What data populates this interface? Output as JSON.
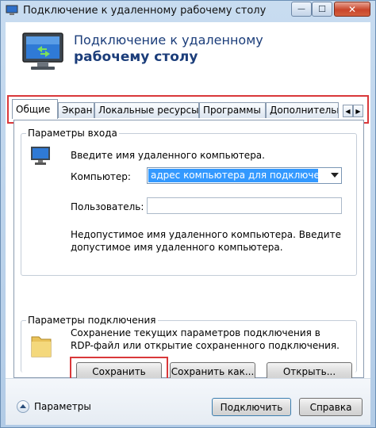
{
  "window": {
    "title": "Подключение к удаленному рабочему столу",
    "minimize_glyph": "—",
    "maximize_glyph": "☐",
    "close_glyph": "✕"
  },
  "header": {
    "line1": "Подключение к удаленному",
    "line2": "рабочему столу"
  },
  "tabs": [
    {
      "label": "Общие",
      "active": true
    },
    {
      "label": "Экран"
    },
    {
      "label": "Локальные ресурсы"
    },
    {
      "label": "Программы"
    },
    {
      "label": "Дополнительно"
    }
  ],
  "tab_scroll": {
    "left": "◀",
    "right": "▶"
  },
  "login": {
    "group_label": "Параметры входа",
    "instruction": "Введите имя удаленного компьютера.",
    "computer_label": "Компьютер:",
    "computer_value": "адрес компьютера для подключения>",
    "user_label": "Пользователь:",
    "user_value": "",
    "error_line1": "Недопустимое имя удаленного компьютера. Введите",
    "error_line2": "допустимое имя удаленного компьютера."
  },
  "connection": {
    "group_label": "Параметры подключения",
    "desc_line1": "Сохранение текущих параметров подключения в",
    "desc_line2": "RDP-файл или открытие сохраненного подключения.",
    "save_label": "Сохранить",
    "save_as_label": "Сохранить как...",
    "open_label": "Открыть..."
  },
  "footer": {
    "options_label": "Параметры",
    "connect_label": "Подключить",
    "help_label": "Справка"
  },
  "colors": {
    "highlight_box": "#d9383a",
    "selection": "#3399ff",
    "header_text": "#1b3d7a"
  }
}
